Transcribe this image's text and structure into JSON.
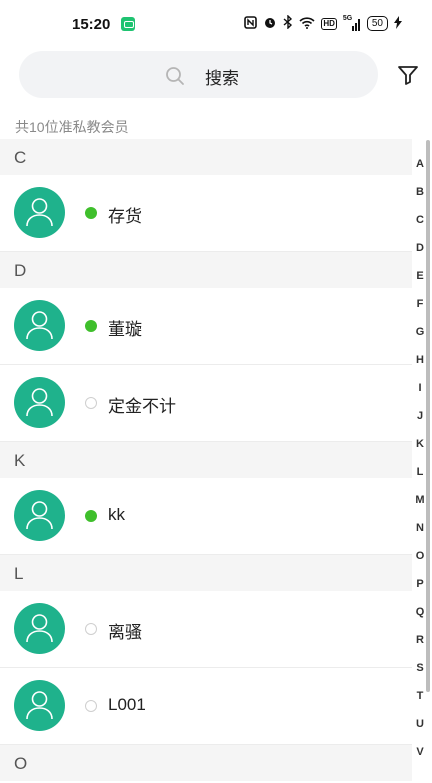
{
  "status_bar": {
    "time": "15:20",
    "battery": "50",
    "icons": [
      "app-notification-icon",
      "nfc-icon",
      "alarm-icon",
      "bluetooth-icon",
      "wifi-icon",
      "hd-icon",
      "signal-5g-icon",
      "battery-icon",
      "charging-icon"
    ],
    "signal_label": "5G",
    "hd_label": "HD"
  },
  "search": {
    "placeholder": "搜索"
  },
  "summary": "共10位准私教会员",
  "sections": [
    {
      "letter": "C",
      "members": [
        {
          "name": "存货",
          "online": true
        }
      ]
    },
    {
      "letter": "D",
      "members": [
        {
          "name": "董璇",
          "online": true
        },
        {
          "name": "定金不计",
          "online": false
        }
      ]
    },
    {
      "letter": "K",
      "members": [
        {
          "name": "kk",
          "online": true
        }
      ]
    },
    {
      "letter": "L",
      "members": [
        {
          "name": "离骚",
          "online": false
        },
        {
          "name": "L001",
          "online": false
        }
      ]
    },
    {
      "letter": "O",
      "members": []
    }
  ],
  "index_letters": [
    "A",
    "B",
    "C",
    "D",
    "E",
    "F",
    "G",
    "H",
    "I",
    "J",
    "K",
    "L",
    "M",
    "N",
    "O",
    "P",
    "Q",
    "R",
    "S",
    "T",
    "U",
    "V"
  ],
  "colors": {
    "accent": "#1fb28c",
    "online": "#3fbf2c",
    "search_bg": "#f2f3f5",
    "section_bg": "#f5f5f5"
  }
}
